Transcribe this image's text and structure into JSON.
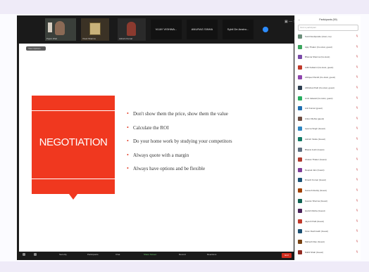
{
  "top": {
    "thumbnails": [
      {
        "label": "Puja's iPad"
      },
      {
        "label": "Vivek Sharma"
      },
      {
        "label": "Ashwin Kumar"
      }
    ],
    "name_tiles": [
      "VIJAY VISHWA...",
      "ANURAG SINHA",
      "Sybil De Anstro..."
    ],
    "window_controls": "▣ — ✕"
  },
  "slide": {
    "view_label": "View Options",
    "title": "NEGOTIATION",
    "bullets": [
      "Don't show them the price, show them the value",
      "Calculate the ROI",
      "Do your home work by studying your competitors",
      "Always quote with a margin",
      "Always have options and be flexible"
    ]
  },
  "toolbar": {
    "items": [
      "Unmute",
      "Start Video",
      "Security",
      "Participants",
      "Chat",
      "Share Screen",
      "Record",
      "Reactions"
    ],
    "end_label": "End"
  },
  "participants": {
    "title": "Participants (59)",
    "search_placeholder": "Find a participant",
    "list": [
      {
        "name": "Sunil Deshpande (Host, me)",
        "color": "#6b8e7a"
      },
      {
        "name": "Ajay Thakur (Co-Host, guest)",
        "color": "#3aa55d"
      },
      {
        "name": "Bhavna Sharma (Co-Host)",
        "color": "#7a4aa8"
      },
      {
        "name": "Aditi Kulkarni (Co-Host, guest)",
        "color": "#c0392b"
      },
      {
        "name": "Abhijeet Pandit (Co-Host, guest)",
        "color": "#8e44ad"
      },
      {
        "name": "Abhishek Patil (Co-Host, guest)",
        "color": "#2c3e50"
      },
      {
        "name": "Amit Jaiswal (Co-Host, guest)",
        "color": "#27ae60"
      },
      {
        "name": "Anil Kumar (guest)",
        "color": "#1f6fb2"
      },
      {
        "name": "Ankur Mehta (guest)",
        "color": "#6d4c41"
      },
      {
        "name": "Apurva Singh (Guest)",
        "color": "#2e86c1"
      },
      {
        "name": "Ashish Yadav (Guest)",
        "color": "#117a65"
      },
      {
        "name": "Bharat Joshi (Guest)",
        "color": "#5d6d7e"
      },
      {
        "name": "Chetan Thakur (Guest)",
        "color": "#b03a2e"
      },
      {
        "name": "Deepak Jain (Guest)",
        "color": "#7d3c98"
      },
      {
        "name": "Dinesh Kumar (Guest)",
        "color": "#1a5276"
      },
      {
        "name": "Ganesh Reddy (Guest)",
        "color": "#a04000"
      },
      {
        "name": "Gaurav Sharma (Guest)",
        "color": "#0e6251"
      },
      {
        "name": "Harish Mehta (Guest)",
        "color": "#4a235a"
      },
      {
        "name": "Jayesh Patil (Guest)",
        "color": "#c0392b"
      },
      {
        "name": "Kiran Deshmukh (Guest)",
        "color": "#1b4f72"
      },
      {
        "name": "Mahesh Rao (Guest)",
        "color": "#784212"
      },
      {
        "name": "Nikhil Shah (Guest)",
        "color": "#922b21"
      }
    ]
  }
}
